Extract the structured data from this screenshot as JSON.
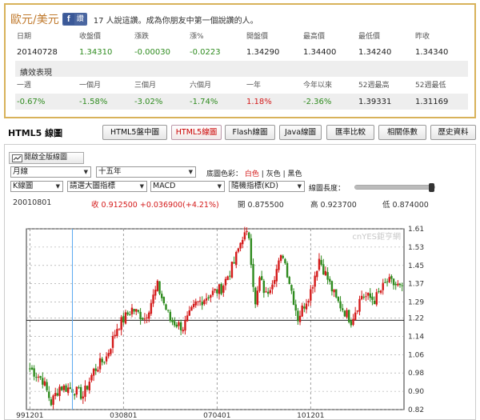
{
  "quote": {
    "pair": "歐元/美元",
    "like_label": "讚",
    "like_text": "17 人說這讚。成為你朋友中第一個說讚的人。",
    "headers": [
      "日期",
      "收盤價",
      "漲跌",
      "漲%",
      "開盤價",
      "最高價",
      "最低價",
      "昨收"
    ],
    "values": [
      "20140728",
      "1.34310",
      "-0.00030",
      "-0.0223",
      "1.34290",
      "1.34400",
      "1.34240",
      "1.34340"
    ],
    "value_colors": [
      "#222222",
      "#2e8b1e",
      "#2e8b1e",
      "#2e8b1e",
      "#222222",
      "#222222",
      "#222222",
      "#222222"
    ]
  },
  "performance": {
    "title": "績效表現",
    "headers": [
      "一週",
      "一個月",
      "三個月",
      "六個月",
      "一年",
      "今年以來",
      "52週最高",
      "52週最低"
    ],
    "values": [
      "-0.67%",
      "-1.58%",
      "-3.02%",
      "-1.74%",
      "1.18%",
      "-2.36%",
      "1.39331",
      "1.31169"
    ],
    "value_colors": [
      "#2e8b1e",
      "#2e8b1e",
      "#2e8b1e",
      "#2e8b1e",
      "#d41a1a",
      "#2e8b1e",
      "#222222",
      "#222222"
    ]
  },
  "chart_section": {
    "title": "HTML5 線圖",
    "tabs": [
      {
        "label": "HTML5盤中圖",
        "active": false
      },
      {
        "label": "HTML5線圖",
        "active": true
      },
      {
        "label": "Flash線圖",
        "active": false
      },
      {
        "label": "Java線圖",
        "active": false
      },
      {
        "label": "匯率比較",
        "active": false
      },
      {
        "label": "相關係數",
        "active": false
      },
      {
        "label": "歷史資料",
        "active": false
      }
    ],
    "full_chart_button": "開啟全版線圖"
  },
  "controls": {
    "period_select": "月線",
    "range_select": "十五年",
    "background_label": "底圖色彩：",
    "background_options": [
      "白色",
      "灰色",
      "黑色"
    ],
    "background_selected": "白色",
    "separator": "|",
    "chart_type_select": "K線圖",
    "overlay_select": "請選大圖指標",
    "indicator1_select": "MACD",
    "indicator2_select": "隨機指標(KD)",
    "length_label": "線圖長度：",
    "length_value": 0.97
  },
  "info": {
    "date": "20010801",
    "close": "收 0.912500 +0.036900(+4.21%)",
    "open": "開 0.875500",
    "high": "高 0.923700",
    "low": "低 0.874000",
    "close_color": "#d41a1a"
  },
  "chart_data": {
    "type": "candlestick",
    "interval": "monthly",
    "watermark": "cnYES鉅亨網",
    "y_ticks": [
      "1.61",
      "1.53",
      "1.45",
      "1.37",
      "1.29",
      "1.22",
      "1.14",
      "1.06",
      "0.98",
      "0.90",
      "0.82"
    ],
    "ylim": [
      0.82,
      1.61
    ],
    "x_ticks": [
      "991201",
      "030801",
      "070401",
      "101201"
    ],
    "reference_line": 1.21,
    "cursor_date": "20010801",
    "up_color": "#d41a1a",
    "down_color": "#2e8b1e",
    "grid": true,
    "closes_by_year": {
      "1999-12": 1.0,
      "2000-06": 0.95,
      "2000-10": 0.85,
      "2001-02": 0.92,
      "2001-08": 0.91,
      "2002-01": 0.88,
      "2002-06": 0.99,
      "2002-12": 1.05,
      "2003-05": 1.18,
      "2003-12": 1.26,
      "2004-06": 1.22,
      "2004-12": 1.36,
      "2005-06": 1.21,
      "2005-12": 1.18,
      "2006-06": 1.28,
      "2006-12": 1.32,
      "2007-06": 1.35,
      "2007-12": 1.46,
      "2008-04": 1.58,
      "2008-07": 1.58,
      "2008-10": 1.27,
      "2008-12": 1.39,
      "2009-03": 1.32,
      "2009-11": 1.5,
      "2010-06": 1.22,
      "2010-12": 1.34,
      "2011-04": 1.48,
      "2011-12": 1.3,
      "2012-07": 1.21,
      "2012-12": 1.32,
      "2013-06": 1.3,
      "2013-12": 1.38,
      "2014-05": 1.36,
      "2014-07": 1.34
    }
  }
}
